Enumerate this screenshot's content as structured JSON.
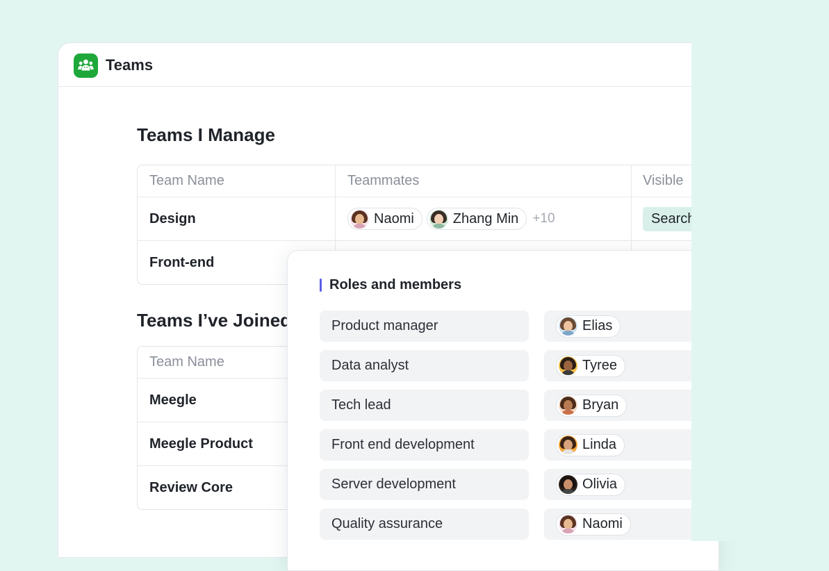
{
  "app": {
    "title": "Teams",
    "icon": "people-group-icon",
    "accent": "#1ea83a"
  },
  "managed": {
    "title": "Teams I Manage",
    "columns": [
      "Team Name",
      "Teammates",
      "Visible"
    ],
    "rows": [
      {
        "name": "Design",
        "teammates": [
          "Naomi",
          "Zhang Min"
        ],
        "more": "+10",
        "visible": "Search"
      },
      {
        "name": "Front-end",
        "teammates": [],
        "more": "",
        "visible": ""
      }
    ]
  },
  "joined": {
    "title": "Teams I’ve Joined",
    "columns": [
      "Team Name"
    ],
    "rows": [
      {
        "name": "Meegle"
      },
      {
        "name": "Meegle Product"
      },
      {
        "name": "Review Core"
      }
    ]
  },
  "roles_panel": {
    "title": "Roles and members",
    "accent": "#5b5fe6",
    "items": [
      {
        "role": "Product manager",
        "member": "Elias"
      },
      {
        "role": "Data analyst",
        "member": "Tyree"
      },
      {
        "role": "Tech lead",
        "member": "Bryan"
      },
      {
        "role": "Front end development",
        "member": "Linda"
      },
      {
        "role": "Server development",
        "member": "Olivia"
      },
      {
        "role": "Quality assurance",
        "member": "Naomi"
      }
    ]
  },
  "colors": {
    "background": "#e2f6f1",
    "tag_bg": "#d9f0ea"
  }
}
